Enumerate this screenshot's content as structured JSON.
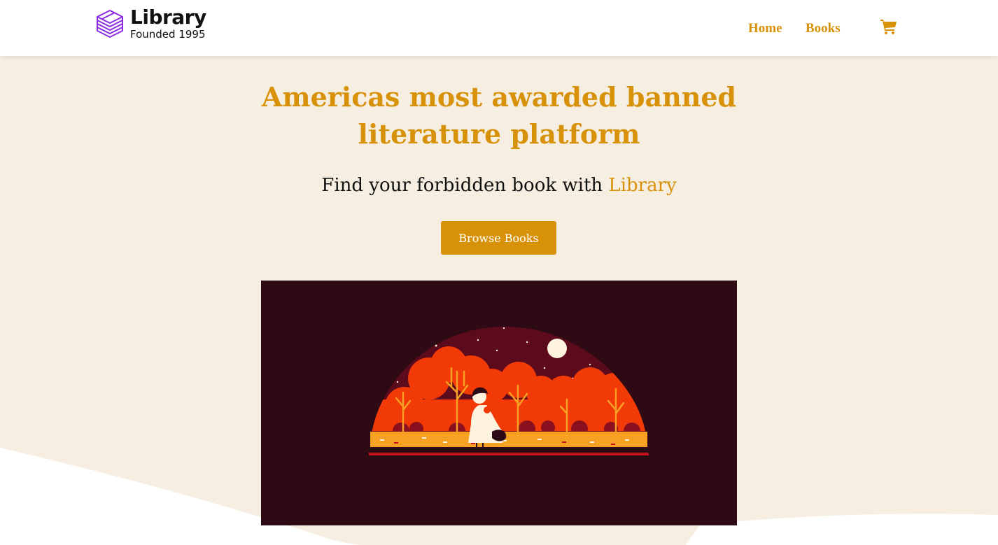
{
  "brand": {
    "title": "Library",
    "subtitle": "Founded 1995",
    "icon": "stacked-books-icon",
    "icon_color": "#8b2be2"
  },
  "nav": {
    "items": [
      {
        "label": "Home"
      },
      {
        "label": "Books"
      }
    ],
    "cart_icon": "shopping-cart-icon"
  },
  "hero": {
    "title": "Americas most awarded banned literature platform",
    "subtitle_prefix": "Find your forbidden book with ",
    "subtitle_accent": "Library",
    "button_label": "Browse Books"
  },
  "colors": {
    "accent": "#d8920a",
    "background": "#f6eee0",
    "illustration_bg": "#2e0a14"
  }
}
